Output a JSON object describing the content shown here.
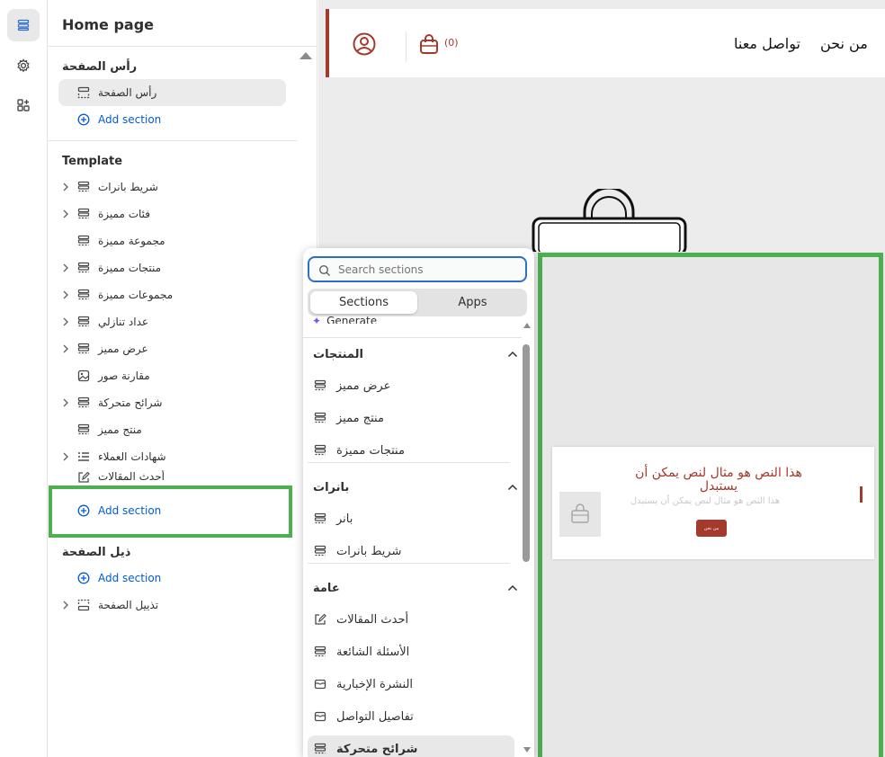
{
  "rail": {
    "items": [
      "sections-icon",
      "settings-icon",
      "apps-icon"
    ]
  },
  "panel": {
    "title": "Home page",
    "header_group": {
      "label": "رأس الصفحة",
      "item": "رأس الصفحة",
      "add": "Add section"
    },
    "template_group": {
      "label": "Template",
      "items": [
        {
          "label": "شريط بانرات",
          "icon": "section-icon",
          "chevron": true
        },
        {
          "label": "فئات مميزة",
          "icon": "section-icon",
          "chevron": true
        },
        {
          "label": "مجموعة مميزة",
          "icon": "section-icon",
          "chevron": false
        },
        {
          "label": "منتجات مميزة",
          "icon": "section-icon",
          "chevron": true
        },
        {
          "label": "مجموعات مميزة",
          "icon": "section-icon",
          "chevron": true
        },
        {
          "label": "عداد تنازلي",
          "icon": "section-icon",
          "chevron": true
        },
        {
          "label": "عرض مميز",
          "icon": "section-icon",
          "chevron": true
        },
        {
          "label": "مقارنة صور",
          "icon": "image-icon",
          "chevron": false
        },
        {
          "label": "شرائح متحركة",
          "icon": "section-icon",
          "chevron": true
        },
        {
          "label": "منتج مميز",
          "icon": "section-icon",
          "chevron": false
        },
        {
          "label": "شهادات العملاء",
          "icon": "list-icon",
          "chevron": true
        },
        {
          "label": "أحدث المقالات",
          "icon": "edit-icon",
          "chevron": false
        }
      ],
      "add": "Add section"
    },
    "footer_group": {
      "label": "ذيل الصفحة",
      "add": "Add section",
      "item": "تذييل الصفحة"
    }
  },
  "preview": {
    "nav": [
      "من نحن",
      "تواصل معنا"
    ],
    "cart_count": "(0)",
    "banner": {
      "heading": "هذا النص هو مثال لنص يمكن أن يستبدل",
      "subtext": "هذا النص هو مثال لنص يمكن أن يستبدل",
      "button": "من نحن"
    },
    "accent": "#a33a2c"
  },
  "popup": {
    "search_placeholder": "Search sections",
    "tabs": [
      "Sections",
      "Apps"
    ],
    "generate": "Generate",
    "groups": [
      {
        "label": "المنتجات",
        "items": [
          {
            "label": "عرض مميز",
            "icon": "section-icon"
          },
          {
            "label": "منتج مميز",
            "icon": "section-icon"
          },
          {
            "label": "منتجات مميزة",
            "icon": "section-icon"
          }
        ]
      },
      {
        "label": "بانرات",
        "items": [
          {
            "label": "بانر",
            "icon": "section-icon"
          },
          {
            "label": "شريط بانرات",
            "icon": "section-icon"
          }
        ]
      },
      {
        "label": "عامة",
        "items": [
          {
            "label": "أحدث المقالات",
            "icon": "edit-icon"
          },
          {
            "label": "الأسئلة الشائعة",
            "icon": "section-icon"
          },
          {
            "label": "النشرة الإخبارية",
            "icon": "mail-icon"
          },
          {
            "label": "تفاصيل التواصل",
            "icon": "mail-icon"
          },
          {
            "label": "شرائح متحركة",
            "icon": "section-icon"
          }
        ]
      }
    ]
  },
  "highlight_color": "#4caf50"
}
